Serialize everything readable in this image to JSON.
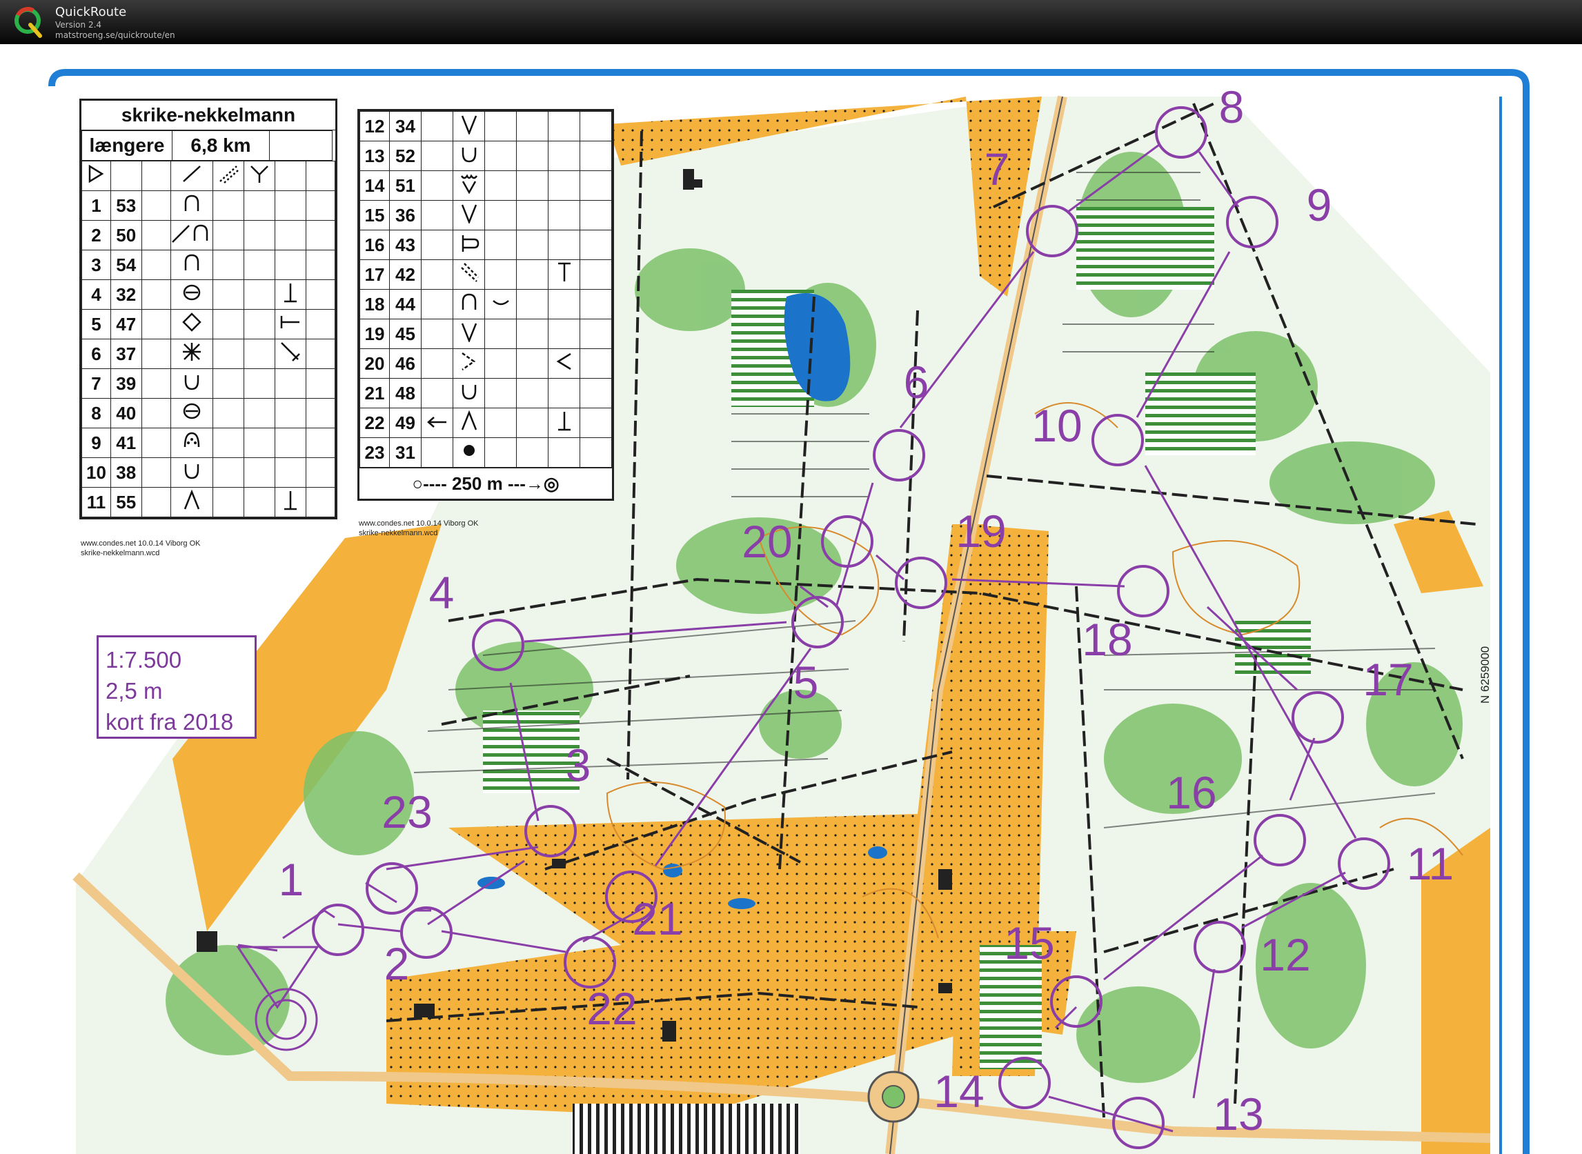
{
  "app": {
    "name": "QuickRoute",
    "version": "Version 2.4",
    "url": "matstroeng.se/quickroute/en"
  },
  "course": {
    "name": "skrike-nekkelmann",
    "class": "længere",
    "length": "6,8 km"
  },
  "descriptions_left": [
    {
      "n": "1",
      "code": "53",
      "sym": "knoll"
    },
    {
      "n": "2",
      "code": "50",
      "sym": "path-knoll"
    },
    {
      "n": "3",
      "code": "54",
      "sym": "knoll"
    },
    {
      "n": "4",
      "code": "32",
      "sym": "pit",
      "pos": "bottom"
    },
    {
      "n": "5",
      "code": "47",
      "sym": "boulder",
      "pos": "side"
    },
    {
      "n": "6",
      "code": "37",
      "sym": "thicket",
      "pos": "corner"
    },
    {
      "n": "7",
      "code": "39",
      "sym": "depression"
    },
    {
      "n": "8",
      "code": "40",
      "sym": "pit"
    },
    {
      "n": "9",
      "code": "41",
      "sym": "rootstock"
    },
    {
      "n": "10",
      "code": "38",
      "sym": "depression"
    },
    {
      "n": "11",
      "code": "55",
      "sym": "spur",
      "pos": "bottom"
    }
  ],
  "descriptions_right": [
    {
      "n": "12",
      "code": "34",
      "sym": "reentrant"
    },
    {
      "n": "13",
      "code": "52",
      "sym": "depression"
    },
    {
      "n": "14",
      "code": "51",
      "sym": "erosion"
    },
    {
      "n": "15",
      "code": "36",
      "sym": "reentrant"
    },
    {
      "n": "16",
      "code": "43",
      "sym": "junction"
    },
    {
      "n": "17",
      "code": "42",
      "sym": "path",
      "pos": "top"
    },
    {
      "n": "18",
      "code": "44",
      "sym": "knoll"
    },
    {
      "n": "19",
      "code": "45",
      "sym": "reentrant"
    },
    {
      "n": "20",
      "code": "46",
      "sym": "vee",
      "pos": "angle"
    },
    {
      "n": "21",
      "code": "48",
      "sym": "depression"
    },
    {
      "n": "22",
      "code": "49",
      "sym": "spur",
      "pos": "bottom"
    },
    {
      "n": "23",
      "code": "31",
      "sym": "dot"
    }
  ],
  "finish_line": "250 m",
  "footnotes": {
    "left_line1": "www.condes.net 10.0.14 Viborg OK",
    "left_line2": "skrike-nekkelmann.wcd",
    "right_line1": "www.condes.net 10.0.14 Viborg OK",
    "right_line2": "skrike-nekkelmann.wcd"
  },
  "scale_box": {
    "scale": "1:7.500",
    "contour": "2,5 m",
    "note": "kort fra 2018"
  },
  "grid_label": "N 6259000",
  "controls": [
    {
      "num": "1"
    },
    {
      "num": "2"
    },
    {
      "num": "3"
    },
    {
      "num": "4"
    },
    {
      "num": "5"
    },
    {
      "num": "6"
    },
    {
      "num": "7"
    },
    {
      "num": "8"
    },
    {
      "num": "9"
    },
    {
      "num": "10"
    },
    {
      "num": "11"
    },
    {
      "num": "12"
    },
    {
      "num": "13"
    },
    {
      "num": "14"
    },
    {
      "num": "15"
    },
    {
      "num": "16"
    },
    {
      "num": "17"
    },
    {
      "num": "18"
    },
    {
      "num": "19"
    },
    {
      "num": "20"
    },
    {
      "num": "21"
    },
    {
      "num": "22"
    },
    {
      "num": "23"
    }
  ],
  "colors": {
    "course": "#8a3fa8",
    "field": "#f4b23c",
    "forest": "#6fb55c",
    "white": "#ffffff",
    "frame": "#1f7fd6",
    "water": "#1b74c9"
  }
}
